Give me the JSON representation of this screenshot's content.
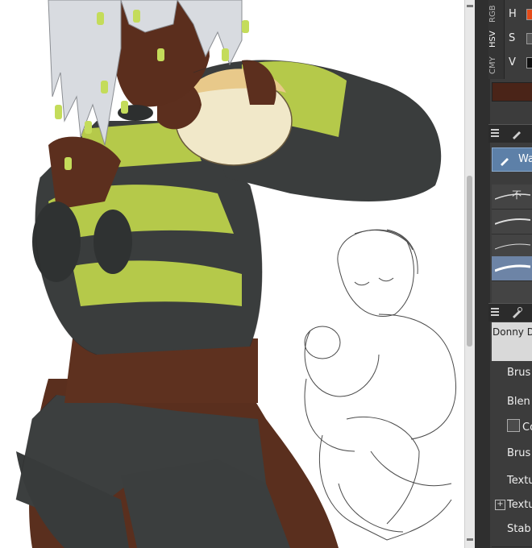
{
  "color_panel": {
    "tabs": [
      "RGB",
      "HSV",
      "CMY"
    ],
    "rows": [
      {
        "label": "H"
      },
      {
        "label": "S"
      },
      {
        "label": "V"
      }
    ],
    "main_color": "#4a2418",
    "h_indicator_color": "#e24b1a"
  },
  "brush_panel": {
    "active_brush": "Wa",
    "item_label": "不"
  },
  "tool_property": {
    "brush_name": "Donny D",
    "rows": [
      "Brus",
      "Blen",
      "Co",
      "Brus",
      "Textu",
      "Textu",
      "Stab"
    ]
  },
  "artwork": {
    "skin": "#5c2f1e",
    "jacket_green": "#b5c94a",
    "jacket_dark": "#3a3d3d",
    "hair": "#d8dbe0",
    "bun": "#f1e8c9"
  }
}
